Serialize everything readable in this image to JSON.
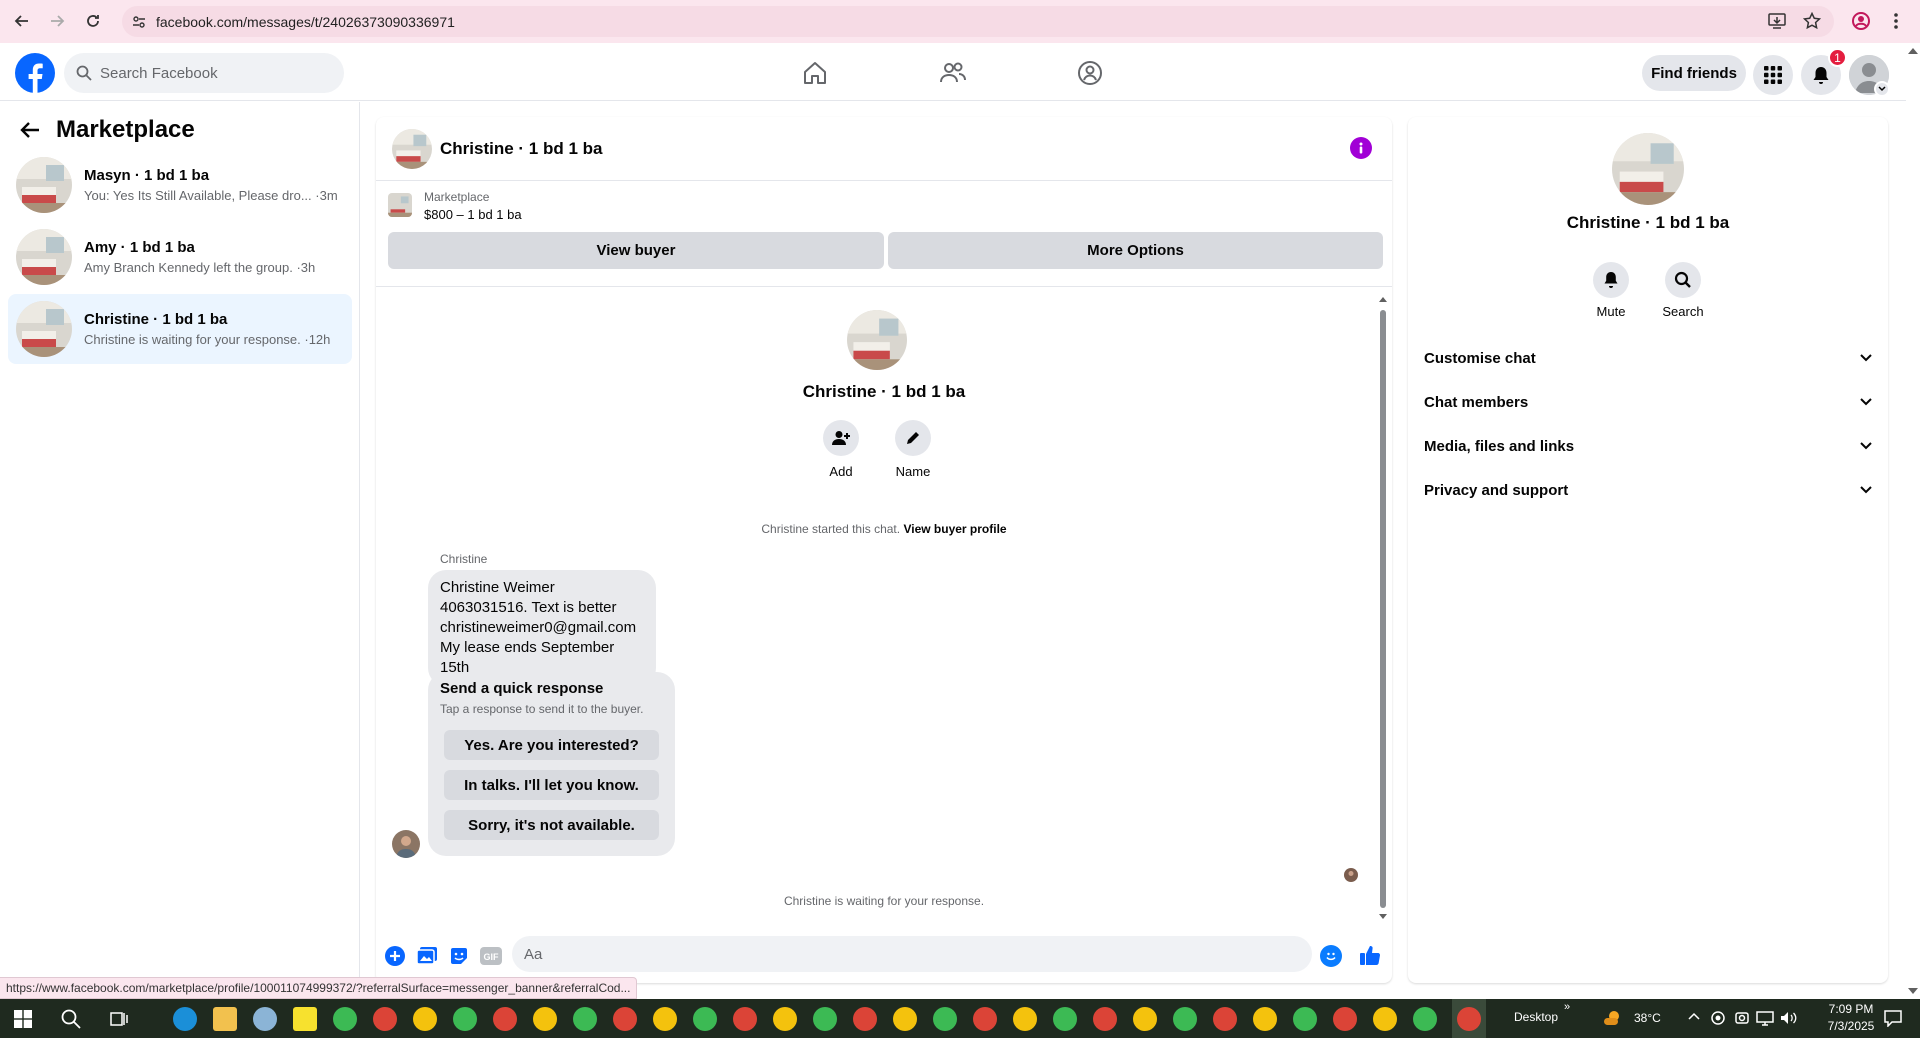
{
  "browser": {
    "url": "facebook.com/messages/t/24026373090336971"
  },
  "topbar": {
    "search_placeholder": "Search Facebook",
    "find_friends_label": "Find friends",
    "notification_count": "1"
  },
  "sidebar": {
    "title": "Marketplace",
    "conversations": [
      {
        "name": "Masyn · 1 bd 1 ba",
        "preview": "You: Yes Its Still Available, Please dro... ·3m"
      },
      {
        "name": "Amy · 1 bd 1 ba",
        "preview": "Amy Branch Kennedy left the group. ·3h"
      },
      {
        "name": "Christine · 1 bd 1 ba",
        "preview": "Christine is waiting for your response. ·12h"
      }
    ]
  },
  "chat": {
    "title": "Christine · 1 bd 1 ba",
    "marketplace_label": "Marketplace",
    "listing": "$800 – 1 bd 1 ba",
    "view_buyer_label": "View buyer",
    "more_options_label": "More Options",
    "center_name": "Christine · 1 bd 1 ba",
    "add_label": "Add",
    "name_label": "Name",
    "started_text": "Christine started this chat.",
    "view_profile_link": "View buyer profile",
    "sender": "Christine",
    "message_lines": [
      "Christine Weimer",
      "4063031516.  Text is better",
      "christineweimer0@gmail.com",
      "My lease ends September 15th"
    ],
    "quick_title": "Send a quick response",
    "quick_subtitle": "Tap a response to send it to the buyer.",
    "quick_responses": [
      "Yes. Are you interested?",
      "In talks. I'll let you know.",
      "Sorry, it's not available."
    ],
    "waiting_text": "Christine is waiting for your response.",
    "composer_placeholder": "Aa"
  },
  "details": {
    "name": "Christine · 1 bd 1 ba",
    "mute_label": "Mute",
    "search_label": "Search",
    "sections": [
      "Customise chat",
      "Chat members",
      "Media, files and links",
      "Privacy and support"
    ]
  },
  "status_link": "https://www.facebook.com/marketplace/profile/100011074999372/?referralSurface=messenger_banner&referralCod...",
  "taskbar": {
    "desktop_label": "Desktop",
    "weather": "38°C",
    "time": "7:09 PM",
    "date": "7/3/2025"
  },
  "colors": {
    "brand": "#0866ff",
    "info": "#a100d6",
    "active_conv": "#ebf5ff",
    "browser_bar": "#fbe6ee"
  }
}
